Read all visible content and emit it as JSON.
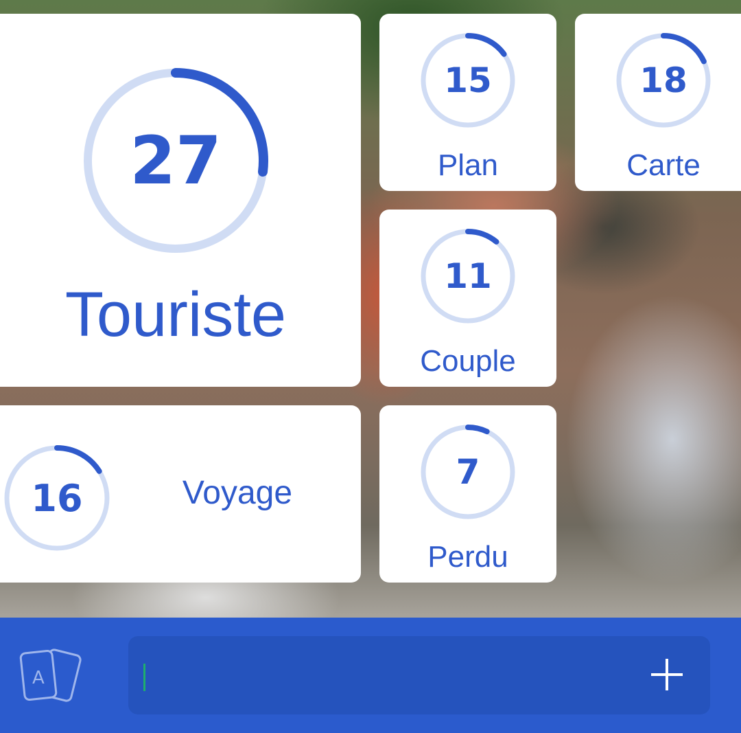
{
  "tiles": [
    {
      "id": "touriste",
      "word": "Touriste",
      "count": "27",
      "progress": 0.27
    },
    {
      "id": "plan",
      "word": "Plan",
      "count": "15",
      "progress": 0.15
    },
    {
      "id": "carte",
      "word": "Carte",
      "count": "18",
      "progress": 0.18
    },
    {
      "id": "couple",
      "word": "Couple",
      "count": "11",
      "progress": 0.11
    },
    {
      "id": "voyage",
      "word": "Voyage",
      "count": "16",
      "progress": 0.16
    },
    {
      "id": "perdu",
      "word": "Perdu",
      "count": "7",
      "progress": 0.07
    }
  ],
  "colors": {
    "accent": "#2f5acb",
    "ring_track": "#d0dcf4",
    "bottom_bar": "#2b5bcd",
    "input_bg": "#2553bd",
    "caret": "#1fae6d"
  },
  "bottom_bar": {
    "cards_icon": "cards-icon",
    "cards_icon_letter": "A",
    "input_value": "",
    "add_icon": "plus-icon"
  }
}
